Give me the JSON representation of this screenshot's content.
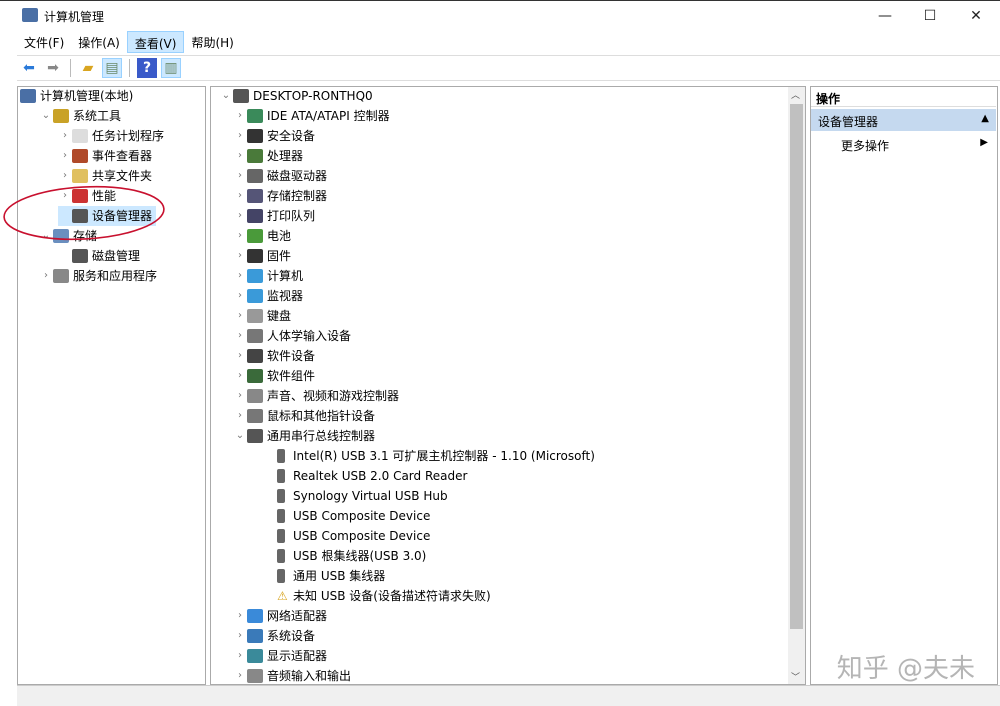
{
  "window": {
    "title": "计算机管理",
    "minimize": "—",
    "maximize": "☐",
    "close": "✕"
  },
  "menu": [
    {
      "label": "文件(F)"
    },
    {
      "label": "操作(A)"
    },
    {
      "label": "查看(V)"
    },
    {
      "label": "帮助(H)"
    }
  ],
  "toolbar": {
    "back": "back-icon",
    "forward": "forward-icon",
    "up": "up-folder-icon",
    "show_tree": "console-tree-icon",
    "help": "help-icon",
    "action_pane": "action-pane-icon"
  },
  "left_tree": [
    {
      "label": "计算机管理(本地)",
      "depth": 0,
      "chev": "",
      "color": "#4a6fa5"
    },
    {
      "label": "系统工具",
      "depth": 1,
      "chev": "⌄",
      "color": "#c9a227"
    },
    {
      "label": "任务计划程序",
      "depth": 2,
      "chev": "›",
      "color": "#ddd"
    },
    {
      "label": "事件查看器",
      "depth": 2,
      "chev": "›",
      "color": "#b04a2a"
    },
    {
      "label": "共享文件夹",
      "depth": 2,
      "chev": "›",
      "color": "#e0c060"
    },
    {
      "label": "性能",
      "depth": 2,
      "chev": "›",
      "color": "#c33"
    },
    {
      "label": "设备管理器",
      "depth": 2,
      "chev": "",
      "color": "#555",
      "selected": true
    },
    {
      "label": "存储",
      "depth": 1,
      "chev": "⌄",
      "color": "#6a8fbf"
    },
    {
      "label": "磁盘管理",
      "depth": 2,
      "chev": "",
      "color": "#555"
    },
    {
      "label": "服务和应用程序",
      "depth": 1,
      "chev": "›",
      "color": "#888"
    }
  ],
  "device_tree": {
    "root": "DESKTOP-RONTHQ0",
    "categories": [
      {
        "label": "IDE ATA/ATAPI 控制器",
        "color": "#3a8a5a"
      },
      {
        "label": "安全设备",
        "color": "#333"
      },
      {
        "label": "处理器",
        "color": "#4a7a3a"
      },
      {
        "label": "磁盘驱动器",
        "color": "#666"
      },
      {
        "label": "存储控制器",
        "color": "#557"
      },
      {
        "label": "打印队列",
        "color": "#446"
      },
      {
        "label": "电池",
        "color": "#4a9a3a"
      },
      {
        "label": "固件",
        "color": "#333"
      },
      {
        "label": "计算机",
        "color": "#3a9ad9"
      },
      {
        "label": "监视器",
        "color": "#3a9ad9"
      },
      {
        "label": "键盘",
        "color": "#999"
      },
      {
        "label": "人体学输入设备",
        "color": "#777"
      },
      {
        "label": "软件设备",
        "color": "#444"
      },
      {
        "label": "软件组件",
        "color": "#3a6a3a"
      },
      {
        "label": "声音、视频和游戏控制器",
        "color": "#888"
      },
      {
        "label": "鼠标和其他指针设备",
        "color": "#777"
      },
      {
        "label": "通用串行总线控制器",
        "color": "#555",
        "expanded": true,
        "children": [
          {
            "label": "Intel(R) USB 3.1 可扩展主机控制器 - 1.10 (Microsoft)"
          },
          {
            "label": "Realtek USB 2.0 Card Reader"
          },
          {
            "label": "Synology Virtual USB Hub"
          },
          {
            "label": "USB Composite Device"
          },
          {
            "label": "USB Composite Device"
          },
          {
            "label": "USB 根集线器(USB 3.0)"
          },
          {
            "label": "通用 USB 集线器"
          },
          {
            "label": "未知 USB 设备(设备描述符请求失败)",
            "warning": true
          }
        ]
      },
      {
        "label": "网络适配器",
        "color": "#3a8ad9"
      },
      {
        "label": "系统设备",
        "color": "#3a7ab9"
      },
      {
        "label": "显示适配器",
        "color": "#3a8a9a"
      },
      {
        "label": "音频输入和输出",
        "color": "#888"
      }
    ]
  },
  "actions": {
    "header": "操作",
    "section": "设备管理器",
    "more": "更多操作"
  },
  "watermark": "知乎 @夫未"
}
